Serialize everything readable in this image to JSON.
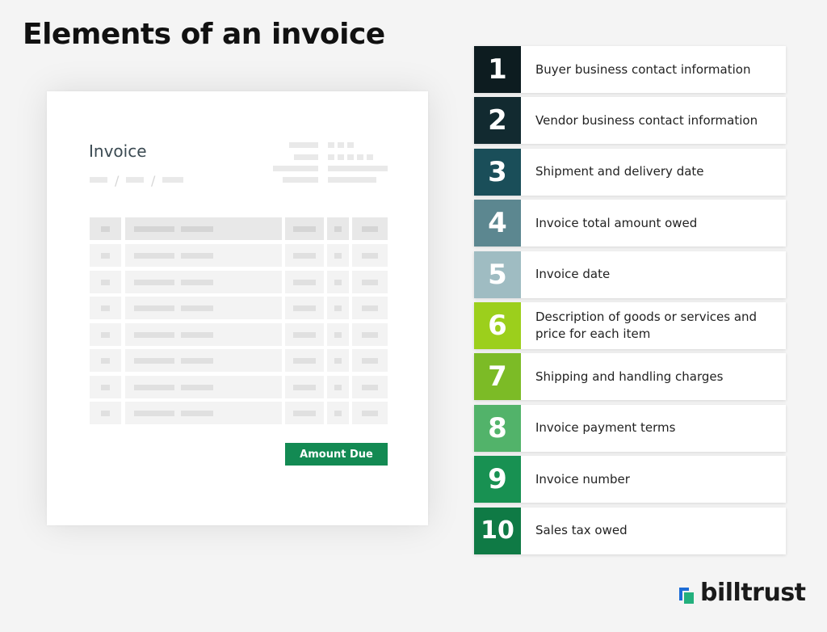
{
  "title": "Elements of an invoice",
  "invoice": {
    "heading": "Invoice",
    "amount_due_label": "Amount Due"
  },
  "legend": {
    "items": [
      {
        "number": "1",
        "label": "Buyer business contact information",
        "color": "#0d1c20"
      },
      {
        "number": "2",
        "label": "Vendor business contact information",
        "color": "#122a30"
      },
      {
        "number": "3",
        "label": "Shipment and delivery date",
        "color": "#1a4e59"
      },
      {
        "number": "4",
        "label": "Invoice total amount owed",
        "color": "#5c8790"
      },
      {
        "number": "5",
        "label": "Invoice date",
        "color": "#9fbcc2"
      },
      {
        "number": "6",
        "label": "Description of goods or services and price for each item",
        "color": "#9ccf1c"
      },
      {
        "number": "7",
        "label": "Shipping and handling charges",
        "color": "#7cbb26"
      },
      {
        "number": "8",
        "label": "Invoice payment terms",
        "color": "#52b36a"
      },
      {
        "number": "9",
        "label": "Invoice number",
        "color": "#189152"
      },
      {
        "number": "10",
        "label": "Sales tax owed",
        "color": "#0f7a45"
      }
    ]
  },
  "logo": {
    "text": "billtrust",
    "icon": "billtrust-logo-icon",
    "colors": [
      "#1d6cd6",
      "#23b07d"
    ]
  }
}
